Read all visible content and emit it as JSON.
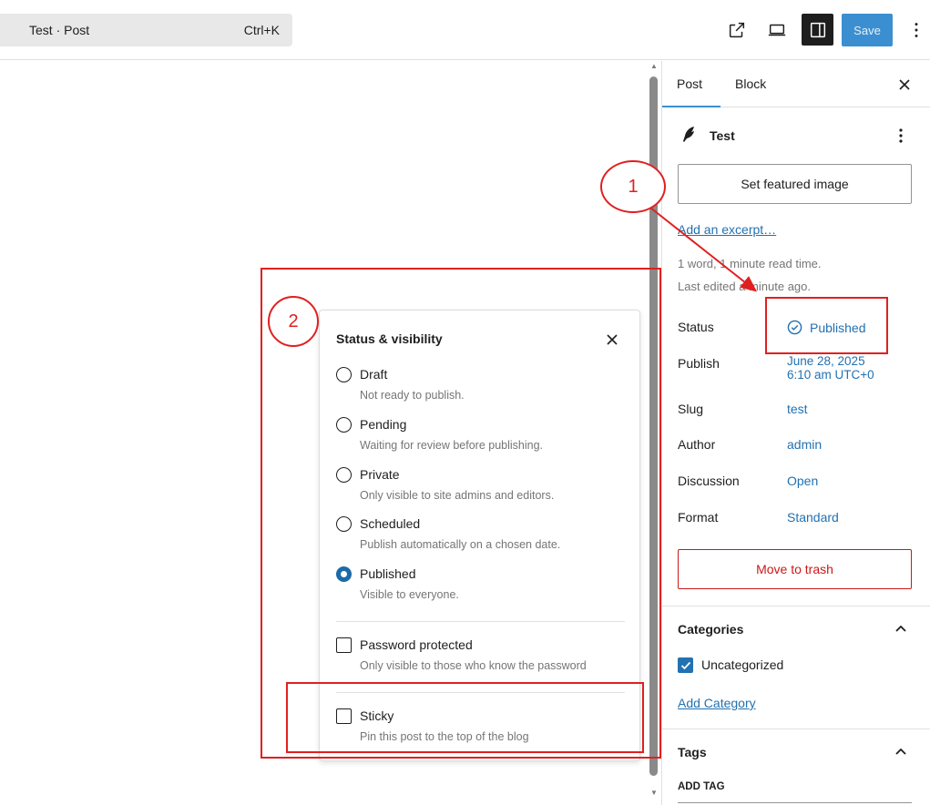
{
  "toolbar": {
    "command_title": "Test · Post",
    "command_shortcut": "Ctrl+K",
    "save_label": "Save"
  },
  "popover": {
    "title": "Status & visibility",
    "options": [
      {
        "label": "Draft",
        "desc": "Not ready to publish.",
        "checked": false
      },
      {
        "label": "Pending",
        "desc": "Waiting for review before publishing.",
        "checked": false
      },
      {
        "label": "Private",
        "desc": "Only visible to site admins and editors.",
        "checked": false
      },
      {
        "label": "Scheduled",
        "desc": "Publish automatically on a chosen date.",
        "checked": false
      },
      {
        "label": "Published",
        "desc": "Visible to everyone.",
        "checked": true
      }
    ],
    "password": {
      "label": "Password protected",
      "desc": "Only visible to those who know the password",
      "checked": false
    },
    "sticky": {
      "label": "Sticky",
      "desc": "Pin this post to the top of the blog",
      "checked": false
    }
  },
  "annotations": {
    "one": "1",
    "two": "2",
    "color": "#e0201f"
  },
  "sidebar": {
    "tab_post": "Post",
    "tab_block": "Block",
    "doc_title": "Test",
    "featured_image": "Set featured image",
    "excerpt_link": "Add an excerpt…",
    "meta_read": "1 word, 1 minute read time.",
    "meta_edited": "Last edited a minute ago.",
    "rows": {
      "status_label": "Status",
      "status_value": "Published",
      "publish_label": "Publish",
      "publish_date": "June 28, 2025",
      "publish_time": "6:10 am UTC+0",
      "slug_label": "Slug",
      "slug_value": "test",
      "author_label": "Author",
      "author_value": "admin",
      "discussion_label": "Discussion",
      "discussion_value": "Open",
      "format_label": "Format",
      "format_value": "Standard"
    },
    "trash": "Move to trash",
    "categories_title": "Categories",
    "category_item": "Uncategorized",
    "add_category": "Add Category",
    "tags_title": "Tags",
    "add_tag": "ADD TAG"
  },
  "colors": {
    "accent": "#2271b1",
    "save_button": "#3b8fd1",
    "danger": "#cc1818",
    "annotation": "#e0201f"
  }
}
